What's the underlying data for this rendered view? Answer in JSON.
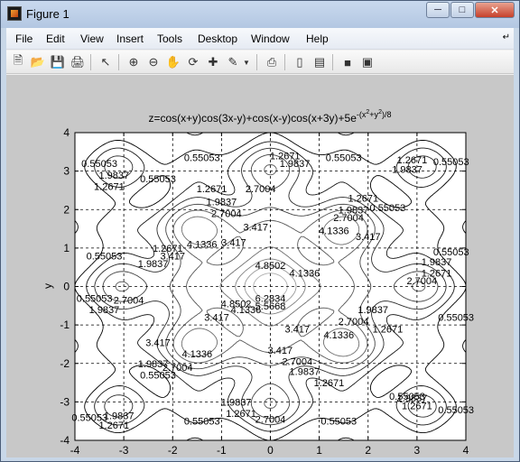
{
  "window": {
    "title": "Figure 1"
  },
  "menu": [
    "File",
    "Edit",
    "View",
    "Insert",
    "Tools",
    "Desktop",
    "Window",
    "Help"
  ],
  "toolbar": [
    "new-figure-icon",
    "open-file-icon",
    "save-icon",
    "print-icon",
    "pointer-icon",
    "zoom-in-icon",
    "zoom-out-icon",
    "pan-icon",
    "rotate-icon",
    "data-cursor-icon",
    "brush-icon",
    "dropdown-icon",
    "link-plot-icon",
    "colorbar-icon",
    "legend-icon",
    "hide-plot-tools-icon",
    "show-plot-tools-icon"
  ],
  "chart_data": {
    "type": "contour",
    "title": "z=cos(x+y)cos(3x-y)+cos(x-y)cos(x+3y)+5e",
    "title_exponent": "-(x",
    "title_exp_sup1": "2",
    "title_exp_mid": "+y",
    "title_exp_sup2": "2",
    "title_exp_end": ")/8",
    "xlabel": "x",
    "ylabel": "y",
    "xlim": [
      -4,
      4
    ],
    "ylim": [
      -4,
      4
    ],
    "xticks": [
      "-4",
      "-3",
      "-2",
      "-1",
      "0",
      "1",
      "2",
      "3",
      "4"
    ],
    "yticks": [
      "4",
      "3",
      "2",
      "1",
      "0",
      "-1",
      "-2",
      "-3",
      "-4"
    ],
    "grid": "dashed",
    "contour_levels": [
      0.55053,
      1.2671,
      1.9837,
      2.7004,
      3.417,
      4.1336,
      4.8502,
      5.5668,
      6.2834
    ],
    "contour_labels": [
      {
        "text": "0.55053",
        "x": -3.5,
        "y": 3.2
      },
      {
        "text": "1.9837",
        "x": -3.2,
        "y": 2.9
      },
      {
        "text": "1.2671",
        "x": -3.3,
        "y": 2.6
      },
      {
        "text": "0.55053",
        "x": -2.3,
        "y": 2.8
      },
      {
        "text": "0.55053",
        "x": -1.4,
        "y": 3.35
      },
      {
        "text": "1.2671",
        "x": -1.2,
        "y": 2.55
      },
      {
        "text": "2.7004",
        "x": -0.2,
        "y": 2.55
      },
      {
        "text": "1.9837",
        "x": -1.0,
        "y": 2.2
      },
      {
        "text": "2.7004",
        "x": -0.9,
        "y": 1.9
      },
      {
        "text": "3.417",
        "x": -0.3,
        "y": 1.55
      },
      {
        "text": "4.1336",
        "x": -1.4,
        "y": 1.1
      },
      {
        "text": "3.417",
        "x": -0.75,
        "y": 1.15
      },
      {
        "text": "1.2671",
        "x": 0.3,
        "y": 3.4
      },
      {
        "text": "1.9837",
        "x": 0.5,
        "y": 3.2
      },
      {
        "text": "0.55053",
        "x": 1.5,
        "y": 3.35
      },
      {
        "text": "1.2671",
        "x": 2.9,
        "y": 3.3
      },
      {
        "text": "1.9837",
        "x": 2.8,
        "y": 3.05
      },
      {
        "text": "0.55053",
        "x": 3.7,
        "y": 3.25
      },
      {
        "text": "0.55053",
        "x": 2.4,
        "y": 2.05
      },
      {
        "text": "1.2671",
        "x": 1.9,
        "y": 2.3
      },
      {
        "text": "1.9837",
        "x": 1.7,
        "y": 2.0
      },
      {
        "text": "2.7004",
        "x": 1.6,
        "y": 1.8
      },
      {
        "text": "3.417",
        "x": 2.0,
        "y": 1.3
      },
      {
        "text": "4.1336",
        "x": 1.3,
        "y": 1.45
      },
      {
        "text": "4.8502",
        "x": 0.0,
        "y": 0.55
      },
      {
        "text": "4.1336",
        "x": 0.7,
        "y": 0.35
      },
      {
        "text": "6.2834",
        "x": 0.0,
        "y": -0.3
      },
      {
        "text": "5.5668",
        "x": 0.0,
        "y": -0.5
      },
      {
        "text": "4.8502",
        "x": -0.7,
        "y": -0.45
      },
      {
        "text": "4.1336",
        "x": -0.5,
        "y": -0.6
      },
      {
        "text": "3.417",
        "x": -1.1,
        "y": -0.8
      },
      {
        "text": "1.2671",
        "x": -2.1,
        "y": 1.0
      },
      {
        "text": "1.9837",
        "x": -2.4,
        "y": 0.6
      },
      {
        "text": "3.417",
        "x": -2.0,
        "y": 0.8
      },
      {
        "text": "0.55053",
        "x": -3.4,
        "y": 0.8
      },
      {
        "text": "0.55053",
        "x": -3.6,
        "y": -0.3
      },
      {
        "text": "1.9837",
        "x": -3.4,
        "y": -0.6
      },
      {
        "text": "2.7004",
        "x": -2.9,
        "y": -0.35
      },
      {
        "text": "1.9837",
        "x": 3.4,
        "y": 0.65
      },
      {
        "text": "0.55053",
        "x": 3.7,
        "y": 0.9
      },
      {
        "text": "2.7004",
        "x": 3.1,
        "y": 0.15
      },
      {
        "text": "1.2671",
        "x": 3.4,
        "y": 0.35
      },
      {
        "text": "1.9837",
        "x": 2.1,
        "y": -0.6
      },
      {
        "text": "2.7004",
        "x": 1.7,
        "y": -0.9
      },
      {
        "text": "1.2671",
        "x": 2.4,
        "y": -1.1
      },
      {
        "text": "0.55053",
        "x": 3.8,
        "y": -0.8
      },
      {
        "text": "3.417",
        "x": 0.55,
        "y": -1.1
      },
      {
        "text": "4.1336",
        "x": 1.4,
        "y": -1.25
      },
      {
        "text": "3.417",
        "x": 0.2,
        "y": -1.65
      },
      {
        "text": "2.7004",
        "x": 0.55,
        "y": -1.95
      },
      {
        "text": "1.9837",
        "x": 0.7,
        "y": -2.2
      },
      {
        "text": "1.2671",
        "x": 1.2,
        "y": -2.5
      },
      {
        "text": "4.1336",
        "x": -1.5,
        "y": -1.75
      },
      {
        "text": "3.417",
        "x": -2.3,
        "y": -1.45
      },
      {
        "text": "2.7004",
        "x": -1.9,
        "y": -2.1
      },
      {
        "text": "1.9837",
        "x": -2.4,
        "y": -2.0
      },
      {
        "text": "0.55053",
        "x": -2.3,
        "y": -2.3
      },
      {
        "text": "1.9837",
        "x": -3.1,
        "y": -3.35
      },
      {
        "text": "1.2671",
        "x": -3.2,
        "y": -3.6
      },
      {
        "text": "0.55053",
        "x": -3.7,
        "y": -3.4
      },
      {
        "text": "0.55053",
        "x": -1.4,
        "y": -3.5
      },
      {
        "text": "1.2671",
        "x": -0.6,
        "y": -3.3
      },
      {
        "text": "1.9837",
        "x": -0.7,
        "y": -3.0
      },
      {
        "text": "2.7004",
        "x": 0.0,
        "y": -3.45
      },
      {
        "text": "0.55053",
        "x": 1.4,
        "y": -3.5
      },
      {
        "text": "0.55053",
        "x": 2.8,
        "y": -2.85
      },
      {
        "text": "1.2671",
        "x": 3.0,
        "y": -3.1
      },
      {
        "text": "1.9837",
        "x": 2.9,
        "y": -2.9
      },
      {
        "text": "0.55053",
        "x": 3.8,
        "y": -3.2
      }
    ]
  }
}
